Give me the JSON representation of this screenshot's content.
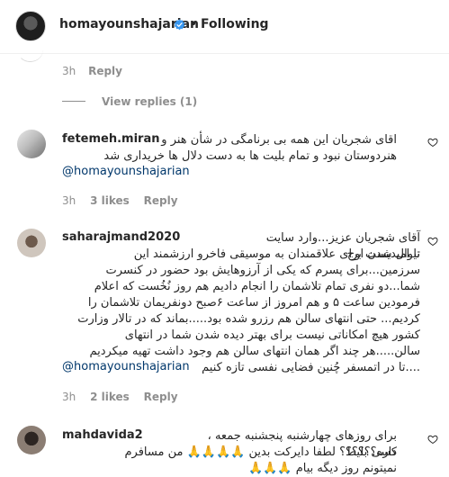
{
  "header": {
    "username": "homayounshajarian",
    "separator": "•",
    "follow_status": "Following"
  },
  "prev_comment": {
    "time": "3h",
    "reply": "Reply"
  },
  "view_replies": "View replies (1)",
  "comments": [
    {
      "username": "fetemeh.miran",
      "lines": [
        "اقای شجریان این همه بی برنامگی در شأن هنر و",
        "هنردوستان نبود و تمام بلیت ها به دست دلال ها خریداری شد"
      ],
      "mention": "@homayounshajarian",
      "time": "3h",
      "likes": "3 likes",
      "reply": "Reply"
    },
    {
      "username": "saharajmand2020",
      "lines": [
        "آقای شجریان عزیز...وارد سایت تیوال شدن اوج",
        "نا امیدیست برای علاقمندان به موسیقی فاخرو ارزشمند این",
        "سرزمین...برای پسرم که یکی از آرزوهایش بود حضور در کنسرت",
        "شما...دو نفری تمام تلاشمان را انجام دادیم هم روز نُخُست که اعلام",
        "فرمودین ساعت ۵ و هم امروز از ساعت ۶صبح دونفریمان تلاشمان را",
        "کردیم... حتی انتهای سالن هم رزرو شده بود.....بماند که در تالار وزارت",
        "کشور هیچ امکاناتی نیست برای بهتر دیده شدن شما در انتهای",
        "سالن.....هر چند اگر همان انتهای سالن هم وجود داشت تهیه میکردیم"
      ],
      "last_line_text": "....تا در اتمسفر چُنین فضایی نفسی تازه کنیم",
      "mention": "@homayounshajarian",
      "time": "3h",
      "likes": "2 likes",
      "reply": "Reply"
    },
    {
      "username": "mahdavida2",
      "lines": [
        "برای روزهای چهارشنبه پنجشنبه جمعه ، کسی بلیط",
        "داره؟؟؟؟؟؟ لطفا دایرکت بدین 🙏🙏🙏🙏 من مسافرم",
        "نمیتونم روز دیگه بیام 🙏🙏🙏"
      ]
    }
  ],
  "colors": {
    "text": "#262626",
    "meta": "#8e8e8e",
    "mention": "#00376b",
    "verified": "#3897f0",
    "border": "#efefef"
  },
  "icons": {
    "verified": "verified-badge-icon",
    "like": "heart-outline-icon"
  }
}
